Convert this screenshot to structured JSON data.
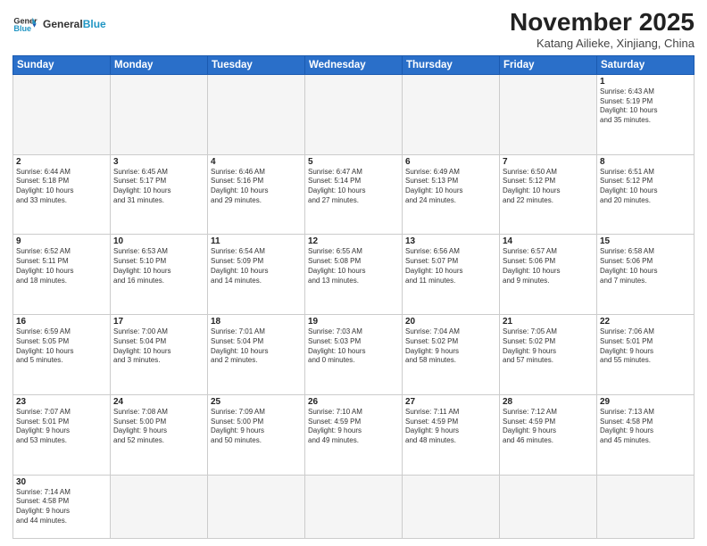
{
  "header": {
    "logo_general": "General",
    "logo_blue": "Blue",
    "title": "November 2025",
    "subtitle": "Katang Ailieke, Xinjiang, China"
  },
  "weekdays": [
    "Sunday",
    "Monday",
    "Tuesday",
    "Wednesday",
    "Thursday",
    "Friday",
    "Saturday"
  ],
  "weeks": [
    [
      {
        "day": "",
        "info": ""
      },
      {
        "day": "",
        "info": ""
      },
      {
        "day": "",
        "info": ""
      },
      {
        "day": "",
        "info": ""
      },
      {
        "day": "",
        "info": ""
      },
      {
        "day": "",
        "info": ""
      },
      {
        "day": "1",
        "info": "Sunrise: 6:43 AM\nSunset: 5:19 PM\nDaylight: 10 hours\nand 35 minutes."
      }
    ],
    [
      {
        "day": "2",
        "info": "Sunrise: 6:44 AM\nSunset: 5:18 PM\nDaylight: 10 hours\nand 33 minutes."
      },
      {
        "day": "3",
        "info": "Sunrise: 6:45 AM\nSunset: 5:17 PM\nDaylight: 10 hours\nand 31 minutes."
      },
      {
        "day": "4",
        "info": "Sunrise: 6:46 AM\nSunset: 5:16 PM\nDaylight: 10 hours\nand 29 minutes."
      },
      {
        "day": "5",
        "info": "Sunrise: 6:47 AM\nSunset: 5:14 PM\nDaylight: 10 hours\nand 27 minutes."
      },
      {
        "day": "6",
        "info": "Sunrise: 6:49 AM\nSunset: 5:13 PM\nDaylight: 10 hours\nand 24 minutes."
      },
      {
        "day": "7",
        "info": "Sunrise: 6:50 AM\nSunset: 5:12 PM\nDaylight: 10 hours\nand 22 minutes."
      },
      {
        "day": "8",
        "info": "Sunrise: 6:51 AM\nSunset: 5:12 PM\nDaylight: 10 hours\nand 20 minutes."
      }
    ],
    [
      {
        "day": "9",
        "info": "Sunrise: 6:52 AM\nSunset: 5:11 PM\nDaylight: 10 hours\nand 18 minutes."
      },
      {
        "day": "10",
        "info": "Sunrise: 6:53 AM\nSunset: 5:10 PM\nDaylight: 10 hours\nand 16 minutes."
      },
      {
        "day": "11",
        "info": "Sunrise: 6:54 AM\nSunset: 5:09 PM\nDaylight: 10 hours\nand 14 minutes."
      },
      {
        "day": "12",
        "info": "Sunrise: 6:55 AM\nSunset: 5:08 PM\nDaylight: 10 hours\nand 13 minutes."
      },
      {
        "day": "13",
        "info": "Sunrise: 6:56 AM\nSunset: 5:07 PM\nDaylight: 10 hours\nand 11 minutes."
      },
      {
        "day": "14",
        "info": "Sunrise: 6:57 AM\nSunset: 5:06 PM\nDaylight: 10 hours\nand 9 minutes."
      },
      {
        "day": "15",
        "info": "Sunrise: 6:58 AM\nSunset: 5:06 PM\nDaylight: 10 hours\nand 7 minutes."
      }
    ],
    [
      {
        "day": "16",
        "info": "Sunrise: 6:59 AM\nSunset: 5:05 PM\nDaylight: 10 hours\nand 5 minutes."
      },
      {
        "day": "17",
        "info": "Sunrise: 7:00 AM\nSunset: 5:04 PM\nDaylight: 10 hours\nand 3 minutes."
      },
      {
        "day": "18",
        "info": "Sunrise: 7:01 AM\nSunset: 5:04 PM\nDaylight: 10 hours\nand 2 minutes."
      },
      {
        "day": "19",
        "info": "Sunrise: 7:03 AM\nSunset: 5:03 PM\nDaylight: 10 hours\nand 0 minutes."
      },
      {
        "day": "20",
        "info": "Sunrise: 7:04 AM\nSunset: 5:02 PM\nDaylight: 9 hours\nand 58 minutes."
      },
      {
        "day": "21",
        "info": "Sunrise: 7:05 AM\nSunset: 5:02 PM\nDaylight: 9 hours\nand 57 minutes."
      },
      {
        "day": "22",
        "info": "Sunrise: 7:06 AM\nSunset: 5:01 PM\nDaylight: 9 hours\nand 55 minutes."
      }
    ],
    [
      {
        "day": "23",
        "info": "Sunrise: 7:07 AM\nSunset: 5:01 PM\nDaylight: 9 hours\nand 53 minutes."
      },
      {
        "day": "24",
        "info": "Sunrise: 7:08 AM\nSunset: 5:00 PM\nDaylight: 9 hours\nand 52 minutes."
      },
      {
        "day": "25",
        "info": "Sunrise: 7:09 AM\nSunset: 5:00 PM\nDaylight: 9 hours\nand 50 minutes."
      },
      {
        "day": "26",
        "info": "Sunrise: 7:10 AM\nSunset: 4:59 PM\nDaylight: 9 hours\nand 49 minutes."
      },
      {
        "day": "27",
        "info": "Sunrise: 7:11 AM\nSunset: 4:59 PM\nDaylight: 9 hours\nand 48 minutes."
      },
      {
        "day": "28",
        "info": "Sunrise: 7:12 AM\nSunset: 4:59 PM\nDaylight: 9 hours\nand 46 minutes."
      },
      {
        "day": "29",
        "info": "Sunrise: 7:13 AM\nSunset: 4:58 PM\nDaylight: 9 hours\nand 45 minutes."
      }
    ],
    [
      {
        "day": "30",
        "info": "Sunrise: 7:14 AM\nSunset: 4:58 PM\nDaylight: 9 hours\nand 44 minutes."
      },
      {
        "day": "",
        "info": ""
      },
      {
        "day": "",
        "info": ""
      },
      {
        "day": "",
        "info": ""
      },
      {
        "day": "",
        "info": ""
      },
      {
        "day": "",
        "info": ""
      },
      {
        "day": "",
        "info": ""
      }
    ]
  ]
}
